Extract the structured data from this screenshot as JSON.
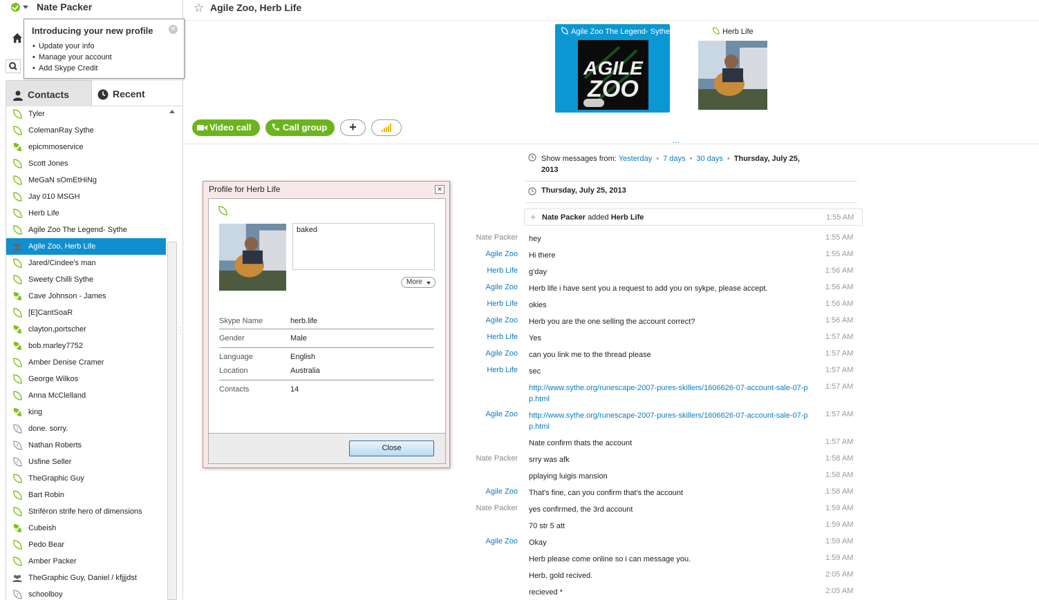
{
  "user": {
    "name": "Nate Packer"
  },
  "tooltip": {
    "title": "Introducing your new profile",
    "items": [
      "Update your info",
      "Manage your account",
      "Add Skype Credit"
    ]
  },
  "tabs": {
    "contacts": "Contacts",
    "recent": "Recent"
  },
  "contacts": [
    {
      "name": "Tyler",
      "status": "offline"
    },
    {
      "name": "ColemanRay Sythe",
      "status": "offline"
    },
    {
      "name": "epicmmoservice",
      "status": "online"
    },
    {
      "name": "Scott Jones",
      "status": "offline"
    },
    {
      "name": "MeGaN sOmEtHiNg",
      "status": "offline"
    },
    {
      "name": "Jay 010 MSGH",
      "status": "offline"
    },
    {
      "name": "Herb Life",
      "status": "offline"
    },
    {
      "name": "Agile Zoo The Legend- Sythe",
      "status": "offline"
    },
    {
      "name": "Agile Zoo, Herb Life",
      "status": "group",
      "selected": true
    },
    {
      "name": "Jared/Cindee's man",
      "status": "offline"
    },
    {
      "name": "Sweety Chilli Sythe",
      "status": "offline"
    },
    {
      "name": "Cave Johnson - James",
      "status": "online"
    },
    {
      "name": "[E]CantSoaR",
      "status": "offline"
    },
    {
      "name": "clayton,portscher",
      "status": "online"
    },
    {
      "name": "bob.marley7752",
      "status": "online"
    },
    {
      "name": "Amber Denise Cramer",
      "status": "offline"
    },
    {
      "name": "George Wilkos",
      "status": "offline"
    },
    {
      "name": "Anna McClelland",
      "status": "offline"
    },
    {
      "name": "king",
      "status": "online"
    },
    {
      "name": "done. sorry.",
      "status": "unknown"
    },
    {
      "name": "Nathan Roberts",
      "status": "unknown"
    },
    {
      "name": "Usfine Seller",
      "status": "unknown"
    },
    {
      "name": "TheGraphic Guy",
      "status": "offline"
    },
    {
      "name": "Bart Robin",
      "status": "offline"
    },
    {
      "name": "Striféron strife hero of dimensions",
      "status": "offline"
    },
    {
      "name": "Cubeish",
      "status": "online"
    },
    {
      "name": "Pedo Bear",
      "status": "offline"
    },
    {
      "name": "Amber Packer",
      "status": "offline"
    },
    {
      "name": "TheGraphic Guy, Daniel / kfjjjdst",
      "status": "group"
    },
    {
      "name": "schoolboy",
      "status": "unknown"
    }
  ],
  "conversation": {
    "title": "Agile Zoo, Herb Life",
    "participants": [
      {
        "name": "Agile Zoo The Legend- Sythe",
        "avatar_text": "AGILE ZOO"
      },
      {
        "name": "Herb Life"
      }
    ],
    "buttons": {
      "video": "Video call",
      "call": "Call group",
      "add": "+"
    },
    "show_from": {
      "label": "Show messages from:",
      "links": [
        "Yesterday",
        "7 days",
        "30 days"
      ],
      "current": "Thursday, July 25, 2013"
    },
    "date_header": "Thursday, July 25, 2013",
    "system": {
      "actor": "Nate Packer",
      "action": "added",
      "target": "Herb Life",
      "time": "1:55 AM"
    },
    "messages": [
      {
        "sender": "Nate Packer",
        "me": true,
        "text": "hey",
        "time": "1:55 AM"
      },
      {
        "sender": "Agile Zoo",
        "text": "Hi there",
        "time": "1:55 AM"
      },
      {
        "sender": "Herb Life",
        "text": "g'day",
        "time": "1:56 AM"
      },
      {
        "sender": "Agile Zoo",
        "text": "Herb life i have sent you a request to add you on sykpe, please accept.",
        "time": "1:56 AM"
      },
      {
        "sender": "Herb Life",
        "text": "okies",
        "time": "1:56 AM"
      },
      {
        "sender": "Agile Zoo",
        "text": "Herb you are the one selling the account correct?",
        "time": "1:56 AM"
      },
      {
        "sender": "Herb Life",
        "text": "Yes",
        "time": "1:57 AM"
      },
      {
        "sender": "Agile Zoo",
        "text": "can you link me to the thread please",
        "time": "1:57 AM"
      },
      {
        "sender": "Herb Life",
        "text": "sec",
        "time": "1:57 AM"
      },
      {
        "sender": "",
        "text": "http://www.sythe.org/runescape-2007-pures-skillers/1606626-07-account-sale-07-pp.html",
        "link": true,
        "time": "1:57 AM"
      },
      {
        "sender": "Agile Zoo",
        "text": "http://www.sythe.org/runescape-2007-pures-skillers/1606626-07-account-sale-07-pp.html",
        "link": true,
        "time": "1:57 AM"
      },
      {
        "sender": "",
        "text": "Nate confirm thats the account",
        "time": "1:57 AM"
      },
      {
        "sender": "Nate Packer",
        "me": true,
        "text": "srry was afk",
        "time": "1:58 AM"
      },
      {
        "sender": "",
        "text": "pplaying luigis mansion",
        "time": "1:58 AM"
      },
      {
        "sender": "Agile Zoo",
        "text": "That's fine, can you confirm that's the account",
        "time": "1:58 AM"
      },
      {
        "sender": "Nate Packer",
        "me": true,
        "text": "yes confirmed, the 3rd account",
        "time": "1:59 AM"
      },
      {
        "sender": "",
        "text": " 70 str 5 att",
        "time": "1:59 AM"
      },
      {
        "sender": "Agile Zoo",
        "text": "Okay",
        "time": "1:59 AM"
      },
      {
        "sender": "",
        "text": "Herb please come online so i can message you.",
        "time": "1:59 AM"
      },
      {
        "sender": "",
        "text": "Herb, gold recived.",
        "time": "2:05 AM"
      },
      {
        "sender": "",
        "text": "recieved *",
        "time": "2:05 AM"
      }
    ]
  },
  "profile_dialog": {
    "title": "Profile for Herb Life",
    "mood": "baked",
    "more": "More",
    "fields": [
      {
        "key": "Skype Name",
        "value": "herb.life"
      },
      {
        "key": "Gender",
        "value": "Male"
      },
      {
        "key": "Language",
        "value": "English"
      },
      {
        "key": "Location",
        "value": "Australia"
      },
      {
        "key": "Contacts",
        "value": "14"
      }
    ],
    "close": "Close"
  },
  "colors": {
    "accent": "#0f8fd0",
    "online": "#7cc21b",
    "call_green": "#6cb41d",
    "link": "#0a7bc1"
  }
}
